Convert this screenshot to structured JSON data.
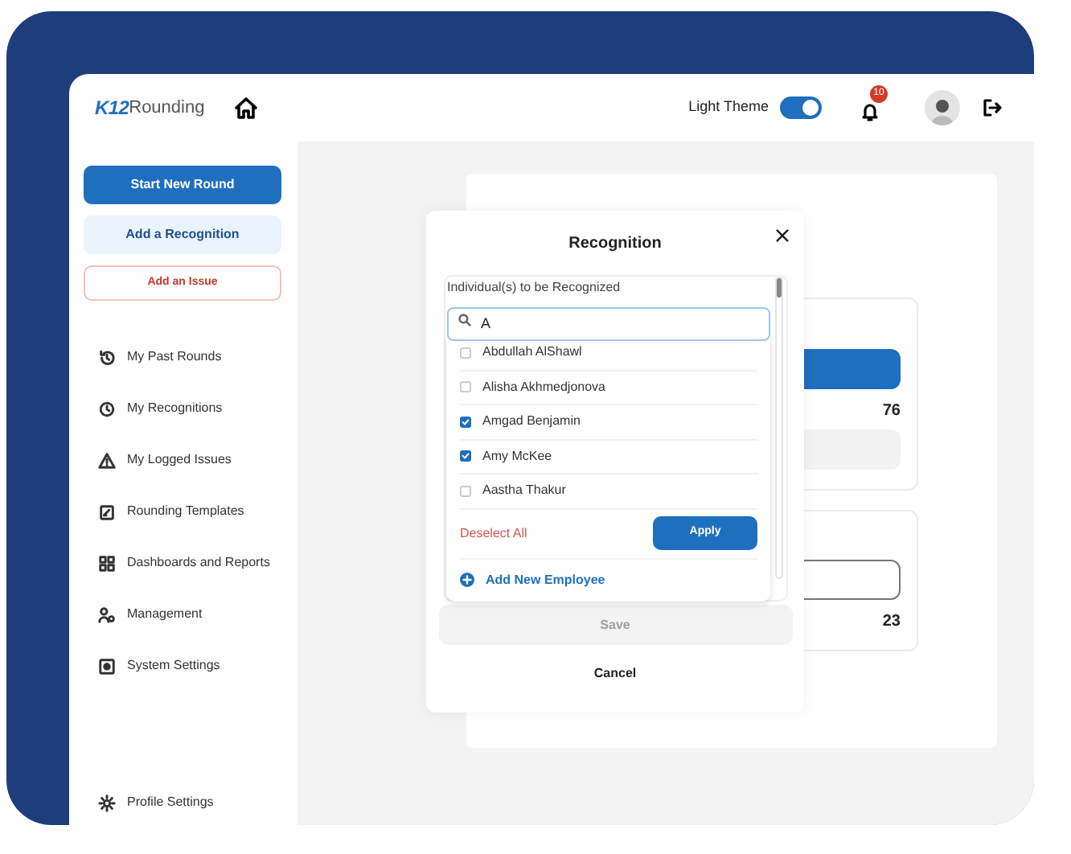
{
  "header": {
    "logo": {
      "mark": "K12",
      "text": "Rounding"
    },
    "theme_toggle": {
      "label": "Light Theme",
      "on": true
    },
    "notifications": {
      "count": "10"
    }
  },
  "sidebar": {
    "actions": [
      {
        "label": "Start New Round",
        "kind": "primary"
      },
      {
        "label": "Add a Recognition",
        "kind": "secondary"
      },
      {
        "label": "Add an Issue",
        "kind": "danger"
      }
    ],
    "items": [
      {
        "label": "My Past Rounds"
      },
      {
        "label": "My Recognitions"
      },
      {
        "label": "My Logged Issues"
      },
      {
        "label": "Rounding Templates"
      },
      {
        "label": "Dashboards and Reports"
      },
      {
        "label": "Management"
      },
      {
        "label": "System Settings"
      }
    ],
    "footer_item": {
      "label": "Profile Settings"
    }
  },
  "background_cards": [
    {
      "kind": "filled",
      "value": "76"
    },
    {
      "kind": "outlined",
      "value": "23"
    }
  ],
  "modal": {
    "title": "Recognition",
    "field_label": "Individual(s) to be Recognized",
    "search": {
      "value": "A"
    },
    "options": [
      {
        "label": "Abdullah AlShawl",
        "checked": false
      },
      {
        "label": "Alisha Akhmedjonova",
        "checked": false
      },
      {
        "label": "Amgad Benjamin",
        "checked": true
      },
      {
        "label": "Amy McKee",
        "checked": true
      },
      {
        "label": "Aastha Thakur",
        "checked": false
      }
    ],
    "deselect_label": "Deselect All",
    "apply_label": "Apply",
    "add_employee_label": "Add New Employee",
    "save": {
      "label": "Save",
      "disabled": true
    },
    "cancel_label": "Cancel"
  }
}
